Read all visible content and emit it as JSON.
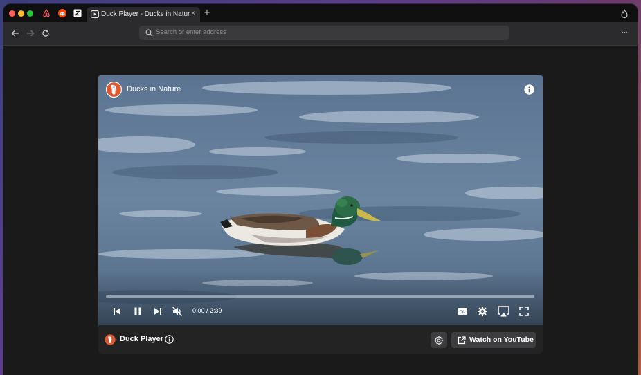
{
  "colors": {
    "traffic_red": "#ff5f57",
    "traffic_yellow": "#febc2e",
    "traffic_green": "#28c840",
    "ddg_orange": "#de5833"
  },
  "tabbar": {
    "pinned_icons": [
      "airbnb-icon",
      "reddit-icon",
      "pinned-site-icon"
    ],
    "active_tab": {
      "title": "Duck Player - Ducks in Nature",
      "close": "×"
    },
    "new_tab": "+"
  },
  "toolbar": {
    "address_placeholder": "Search or enter address",
    "more": "···"
  },
  "player": {
    "title": "Ducks in Nature",
    "time_current": "0:00",
    "time_total": "2:39",
    "time_display": "0:00 / 2:39",
    "progress": 0.0
  },
  "footer": {
    "title": "Duck Player",
    "watch_label": "Watch on YouTube"
  }
}
